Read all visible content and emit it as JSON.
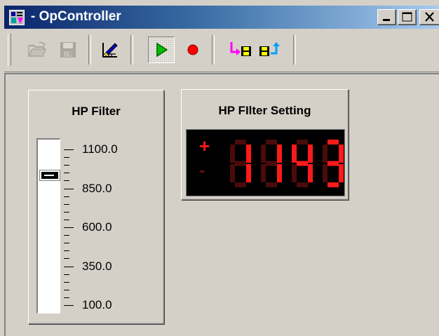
{
  "window": {
    "title": " - OpController",
    "icon": "app-icon",
    "controls": {
      "minimize": "minimize-icon",
      "maximize": "maximize-icon",
      "close": "close-icon"
    }
  },
  "toolbar": {
    "buttons": [
      {
        "name": "open",
        "icon": "folder-open-icon",
        "enabled": false
      },
      {
        "name": "save",
        "icon": "floppy-disk-icon",
        "enabled": false
      },
      {
        "name": "edit",
        "icon": "edit-chart-icon",
        "enabled": true
      },
      {
        "name": "run",
        "icon": "play-icon",
        "enabled": true,
        "pressed": true
      },
      {
        "name": "record",
        "icon": "record-icon",
        "enabled": true
      },
      {
        "name": "load",
        "icon": "load-to-disk-icon",
        "enabled": true
      },
      {
        "name": "upload",
        "icon": "save-upload-icon",
        "enabled": true
      }
    ]
  },
  "hp_filter": {
    "label": "HP Filter",
    "scale_labels": [
      "1100.0",
      "850.0",
      "600.0",
      "350.0",
      "100.0"
    ],
    "min": 100.0,
    "max": 1100.0,
    "value": 940.0
  },
  "setting": {
    "label": "HP FIlter Setting",
    "sign_plus": "+",
    "sign_minus": "-",
    "display_value": "1143",
    "colors": {
      "on": "#ff1a1a",
      "off": "#4a0b0b",
      "background": "#000000"
    }
  }
}
